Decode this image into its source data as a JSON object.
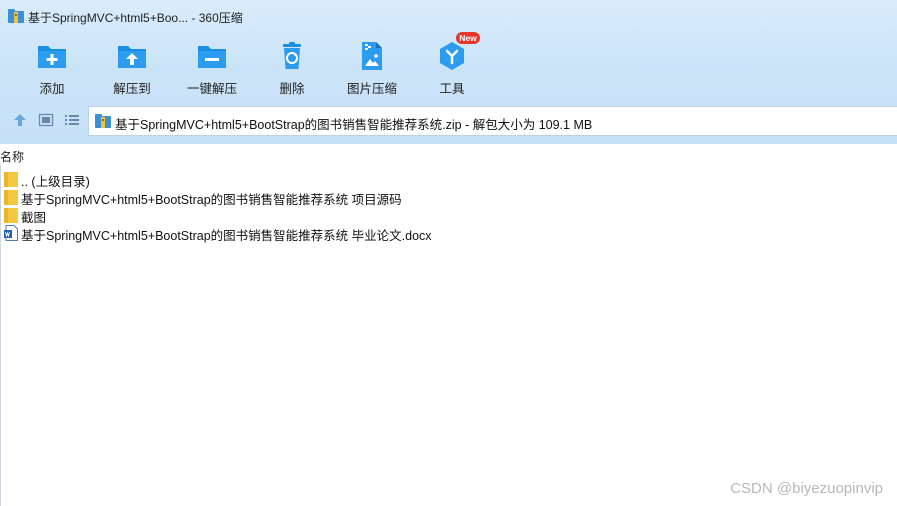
{
  "window": {
    "title": "基于SpringMVC+html5+Boo... - 360压缩"
  },
  "toolbar": {
    "items": [
      {
        "label": "添加",
        "icon": "add-file-icon"
      },
      {
        "label": "解压到",
        "icon": "extract-to-icon"
      },
      {
        "label": "一键解压",
        "icon": "one-click-extract-icon"
      },
      {
        "label": "删除",
        "icon": "recycle-bin-icon"
      },
      {
        "label": "图片压缩",
        "icon": "image-compress-icon"
      },
      {
        "label": "工具",
        "icon": "tools-icon",
        "badge": "New"
      }
    ]
  },
  "address": {
    "text": "基于SpringMVC+html5+BootStrap的图书销售智能推荐系统.zip - 解包大小为 109.1 MB"
  },
  "filelist": {
    "header": "名称",
    "rows": [
      {
        "name": ".. (上级目录)",
        "type": "folder"
      },
      {
        "name": "基于SpringMVC+html5+BootStrap的图书销售智能推荐系统 项目源码",
        "type": "folder"
      },
      {
        "name": "截图",
        "type": "folder"
      },
      {
        "name": "基于SpringMVC+html5+BootStrap的图书销售智能推荐系统 毕业论文.docx",
        "type": "docx"
      }
    ]
  },
  "watermark": "CSDN @biyezuopinvip",
  "colors": {
    "accent": "#1a8fe0",
    "badge": "#e8362d",
    "folder": "#f5c842"
  }
}
